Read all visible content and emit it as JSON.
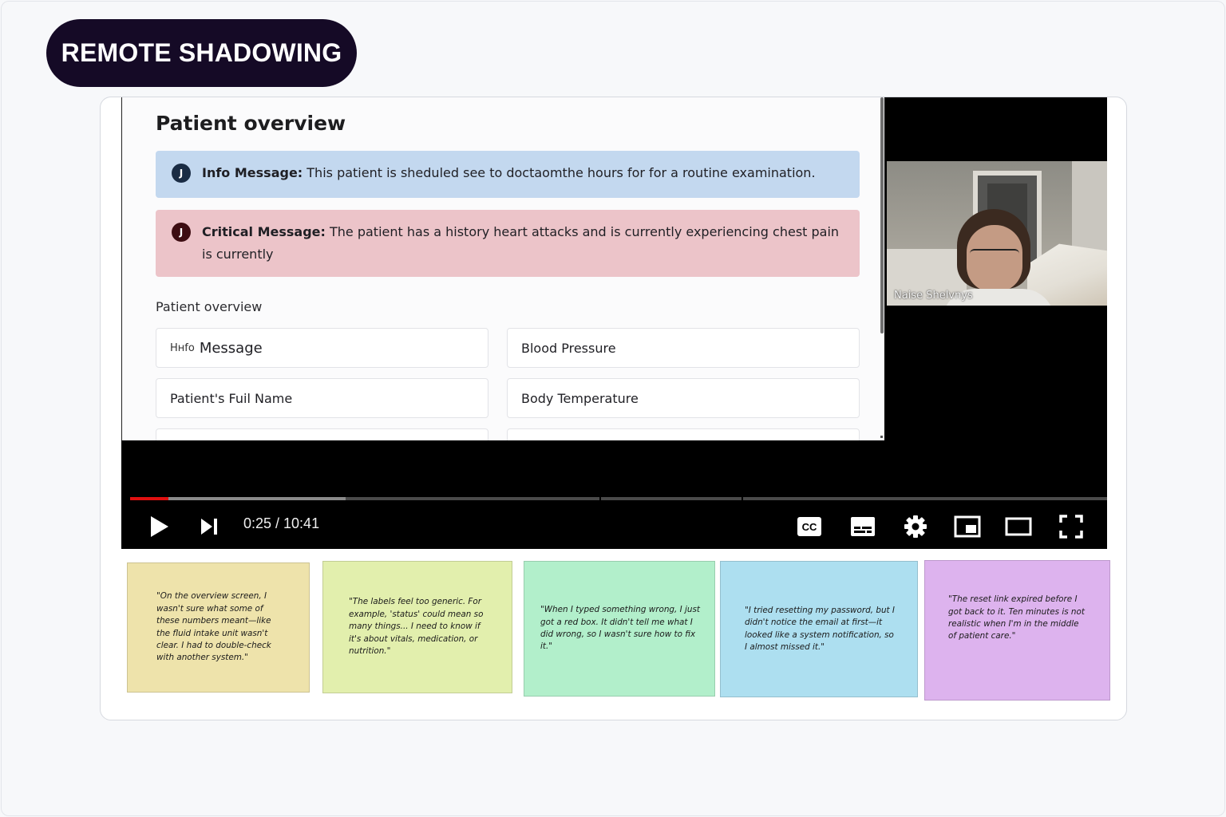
{
  "badge": {
    "label": "REMOTE SHADOWING"
  },
  "recording": {
    "screen": {
      "title": "Patient overview",
      "info_message": {
        "icon_letter": "J",
        "label": "Info Message:",
        "text": "This patient is sheduled see to doctaomthe hours for for a routine examination.",
        "color": "#c3d8ef"
      },
      "critical_message": {
        "icon_letter": "J",
        "label": "Critical Message:",
        "text": "The patient has a history heart attacks and is currently experiencing chest pain is currently",
        "color": "#ecc4c9"
      },
      "section_label": "Patient overview",
      "fields": [
        {
          "prefix": "Hнfo",
          "label": "Message"
        },
        {
          "prefix": "",
          "label": "Blood Pressure"
        },
        {
          "prefix": "",
          "label": "Patient's Fuil Name"
        },
        {
          "prefix": "",
          "label": "Body Temperature"
        }
      ]
    },
    "webcam": {
      "participant_name": "Naise Shelvnys"
    },
    "player": {
      "time_display": "0:25 / 10:41",
      "progress_fraction": 0.039,
      "accent_color": "#e01010",
      "controls": [
        "play-icon",
        "next-icon",
        "cc-icon",
        "subtitles-icon",
        "gear-icon",
        "miniplayer-icon",
        "theater-icon",
        "fullscreen-icon"
      ]
    }
  },
  "notes": [
    {
      "text": "\"On the overview screen, I wasn't sure what some of these numbers meant—like the fluid intake unit wasn't clear. I had to double-check with another system.\"",
      "color": "#eee3ab"
    },
    {
      "text": "\"The labels feel too generic. For example, 'status' could mean so many things... I need to know if it's about vitals, medication, or nutrition.\"",
      "color": "#e2efad"
    },
    {
      "text": "\"When I typed something wrong, I just got a red box. It didn't tell me what I did wrong, so I wasn't sure how to fix it.\"",
      "color": "#b2efcb"
    },
    {
      "text": "\"I tried resetting my password, but I didn't notice the email at first—it looked like a system notification, so I almost missed it.\"",
      "color": "#addff0"
    },
    {
      "text": "\"The reset link expired before I got back to it. Ten minutes is not realistic when I'm in the middle of patient care.\"",
      "color": "#ddb3ee"
    }
  ]
}
